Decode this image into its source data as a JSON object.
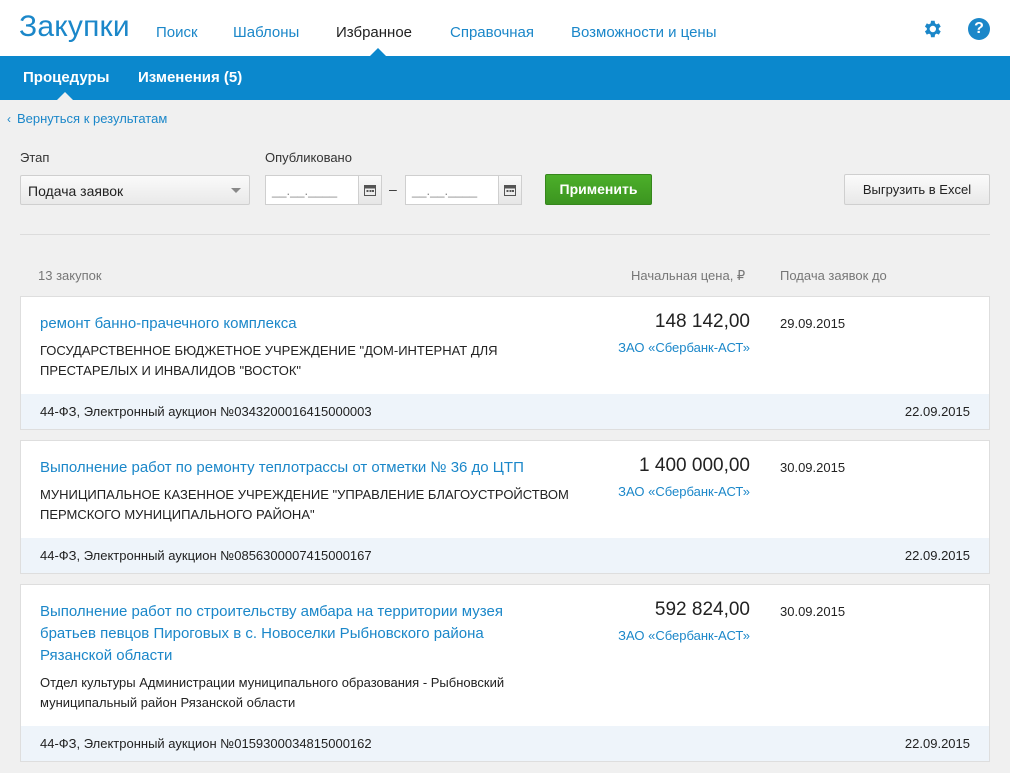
{
  "header": {
    "logo": "Закупки",
    "nav": [
      {
        "label": "Поиск"
      },
      {
        "label": "Шаблоны"
      },
      {
        "label": "Избранное"
      },
      {
        "label": "Справочная"
      },
      {
        "label": "Возможности и цены"
      }
    ],
    "active_nav": "Избранное",
    "icons": [
      "gear-icon",
      "help-icon"
    ],
    "help_glyph": "?"
  },
  "subnav": {
    "items": [
      {
        "label": "Процедуры"
      },
      {
        "label": "Изменения (5)"
      }
    ],
    "active": "Процедуры"
  },
  "back_link": "Вернуться к результатам",
  "filters": {
    "stage_label": "Этап",
    "stage_value": "Подача заявок",
    "published_label": "Опубликовано",
    "date_from_placeholder": "__.__.____",
    "date_to_placeholder": "__.__.____",
    "date_separator": "–",
    "apply_label": "Применить",
    "export_label": "Выгрузить в Excel"
  },
  "list": {
    "count_label": "13 закупок",
    "price_header": "Начальная цена, ₽",
    "deadline_header": "Подача заявок до",
    "items": [
      {
        "title": "ремонт банно-прачечного комплекса",
        "org": "ГОСУДАРСТВЕННОЕ БЮДЖЕТНОЕ УЧРЕЖДЕНИЕ \"ДОМ-ИНТЕРНАТ ДЛЯ ПРЕСТАРЕЛЫХ И ИНВАЛИДОВ \"ВОСТОК\"",
        "price": "148 142,00",
        "operator": "ЗАО «Сбербанк-АСТ»",
        "deadline": "29.09.2015",
        "procedure": "44-ФЗ, Электронный аукцион №0343200016415000003",
        "published": "22.09.2015"
      },
      {
        "title": "Выполнение работ по ремонту теплотрассы от отметки № 36 до ЦТП",
        "org": "МУНИЦИПАЛЬНОЕ КАЗЕННОЕ УЧРЕЖДЕНИЕ \"УПРАВЛЕНИЕ БЛАГОУСТРОЙСТВОМ ПЕРМСКОГО МУНИЦИПАЛЬНОГО РАЙОНА\"",
        "price": "1 400 000,00",
        "operator": "ЗАО «Сбербанк-АСТ»",
        "deadline": "30.09.2015",
        "procedure": "44-ФЗ, Электронный аукцион №0856300007415000167",
        "published": "22.09.2015"
      },
      {
        "title": "Выполнение работ по строительству амбара на территории музея братьев певцов Пироговых в с. Новоселки Рыбновского района Рязанской области",
        "org": "Отдел культуры Администрации муниципального образования - Рыбновский муниципальный район Рязанской области",
        "price": "592 824,00",
        "operator": "ЗАО «Сбербанк-АСТ»",
        "deadline": "30.09.2015",
        "procedure": "44-ФЗ, Электронный аукцион №0159300034815000162",
        "published": "22.09.2015"
      }
    ]
  },
  "colors": {
    "brand_blue": "#1b87c9",
    "subbar_blue": "#0b88cd",
    "apply_green": "#3c9520",
    "footer_tint": "#eef4fa"
  }
}
